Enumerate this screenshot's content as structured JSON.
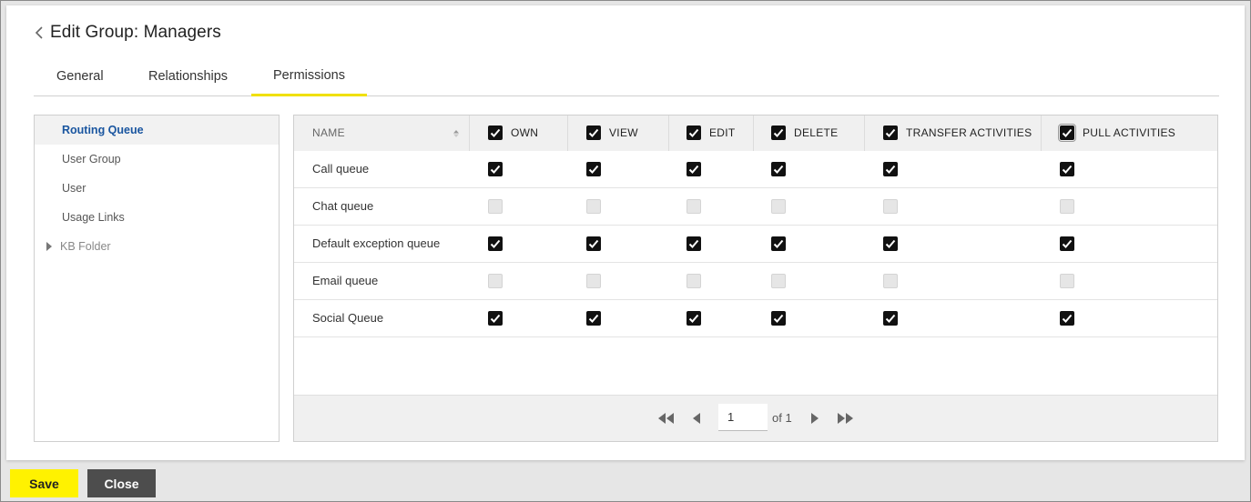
{
  "header": {
    "title": "Edit Group: Managers",
    "back_icon": "chevron-left-icon"
  },
  "tabs": [
    {
      "label": "General",
      "active": false
    },
    {
      "label": "Relationships",
      "active": false
    },
    {
      "label": "Permissions",
      "active": true
    }
  ],
  "sidebar": {
    "items": [
      {
        "label": "Routing Queue",
        "selected": true
      },
      {
        "label": "User Group",
        "selected": false
      },
      {
        "label": "User",
        "selected": false
      },
      {
        "label": "Usage Links",
        "selected": false
      },
      {
        "label": "KB Folder",
        "selected": false,
        "expandable": true
      }
    ]
  },
  "grid": {
    "name_header": "NAME",
    "columns": [
      {
        "label": "OWN",
        "checked": true
      },
      {
        "label": "VIEW",
        "checked": true
      },
      {
        "label": "EDIT",
        "checked": true
      },
      {
        "label": "DELETE",
        "checked": true
      },
      {
        "label": "TRANSFER ACTIVITIES",
        "checked": true
      },
      {
        "label": "PULL ACTIVITIES",
        "checked": true
      }
    ],
    "rows": [
      {
        "name": "Call queue",
        "checks": [
          true,
          true,
          true,
          true,
          true,
          true
        ]
      },
      {
        "name": "Chat queue",
        "checks": [
          false,
          false,
          false,
          false,
          false,
          false
        ]
      },
      {
        "name": "Default exception queue",
        "checks": [
          true,
          true,
          true,
          true,
          true,
          true
        ]
      },
      {
        "name": "Email queue",
        "checks": [
          false,
          false,
          false,
          false,
          false,
          false
        ]
      },
      {
        "name": "Social Queue",
        "checks": [
          true,
          true,
          true,
          true,
          true,
          true
        ]
      }
    ]
  },
  "pager": {
    "page": "1",
    "of_label": "of 1"
  },
  "footer": {
    "save_label": "Save",
    "close_label": "Close"
  },
  "colors": {
    "accent": "#fff200",
    "link": "#1a56a0",
    "dark_button": "#4d4d4d"
  }
}
